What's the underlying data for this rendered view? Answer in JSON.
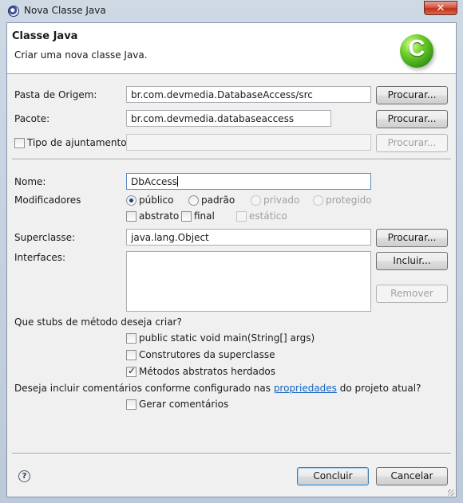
{
  "window": {
    "title": "Nova Classe Java",
    "close_label": "✕"
  },
  "header": {
    "title": "Classe Java",
    "description": "Criar uma nova classe Java.",
    "logo_letter": "C"
  },
  "fields": {
    "source_folder": {
      "label": "Pasta de Origem:",
      "value": "br.com.devmedia.DatabaseAccess/src",
      "button": "Procurar..."
    },
    "package": {
      "label": "Pacote:",
      "value": "br.com.devmedia.databaseaccess",
      "button": "Procurar..."
    },
    "enclosing_type": {
      "label": "Tipo de ajuntamento:",
      "value": "",
      "button": "Procurar...",
      "checked": false
    },
    "name": {
      "label": "Nome:",
      "value": "DbAccess"
    },
    "modifiers": {
      "label": "Modificadores",
      "options": [
        "público",
        "padrão",
        "privado",
        "protegido"
      ],
      "selected": "público",
      "abstract": "abstrato",
      "final": "final",
      "static": "estático"
    },
    "superclass": {
      "label": "Superclasse:",
      "value": "java.lang.Object",
      "button": "Procurar..."
    },
    "interfaces": {
      "label": "Interfaces:",
      "add_button": "Incluir...",
      "remove_button": "Remover"
    }
  },
  "stubs": {
    "question": "Que stubs de método deseja criar?",
    "options": [
      {
        "label": "public static void main(String[] args)",
        "checked": false
      },
      {
        "label": "Construtores da superclasse",
        "checked": false
      },
      {
        "label": "Métodos abstratos herdados",
        "checked": true
      }
    ]
  },
  "comments": {
    "question_before": "Deseja incluir comentários conforme configurado nas ",
    "question_link": "propriedades",
    "question_after": " do projeto atual?",
    "option": "Gerar comentários"
  },
  "footer": {
    "help": "?",
    "finish": "Concluir",
    "cancel": "Cancelar"
  }
}
